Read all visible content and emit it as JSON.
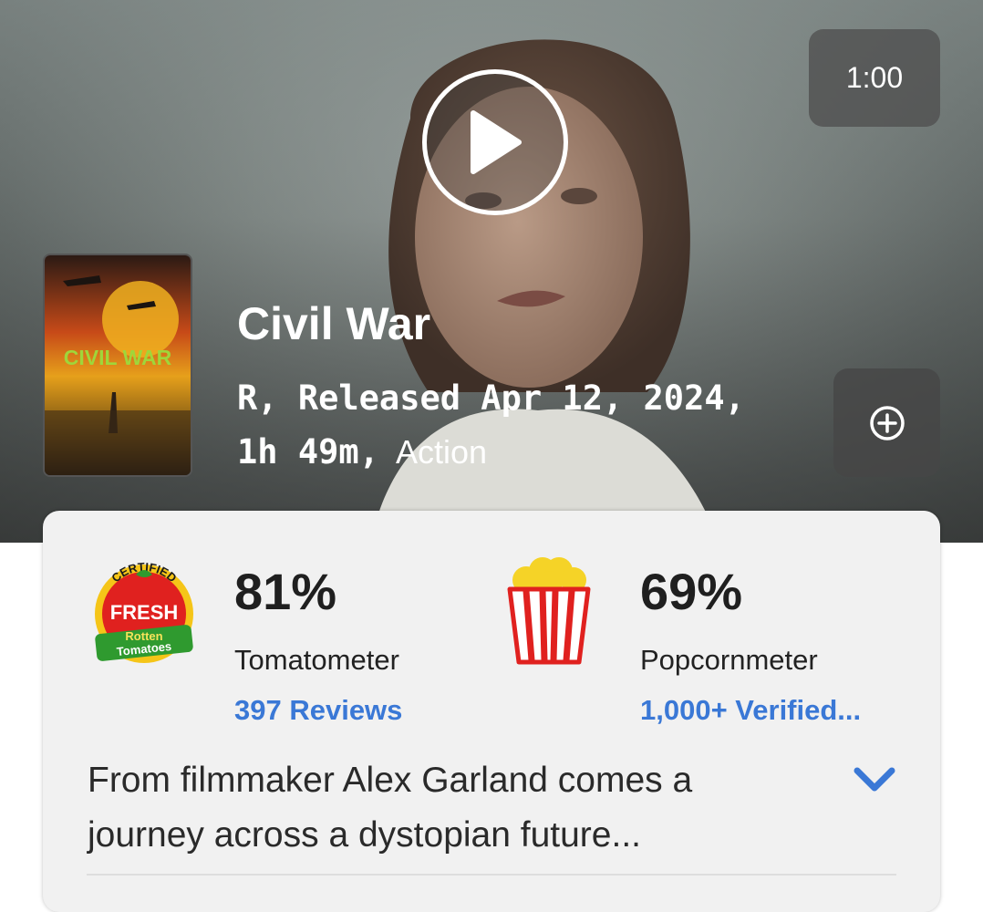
{
  "video": {
    "duration": "1:00"
  },
  "movie": {
    "title": "Civil War",
    "rating_release": "R, Released Apr 12, 2024,",
    "runtime": "1h 49m,",
    "genre": "Action",
    "poster_title": "CIVIL WAR"
  },
  "scores": {
    "tomatometer": {
      "value": "81%",
      "label": "Tomatometer",
      "link": "397 Reviews",
      "badge_top": "CERTIFIED",
      "badge_main": "FRESH",
      "badge_brand1": "Rotten",
      "badge_brand2": "Tomatoes"
    },
    "popcornmeter": {
      "value": "69%",
      "label": "Popcornmeter",
      "link": "1,000+ Verified..."
    }
  },
  "synopsis": "From filmmaker Alex Garland comes a journey across a dystopian future...",
  "colors": {
    "link": "#3a78d6",
    "card_bg": "#f1f1f1",
    "fresh_red": "#e0211f",
    "fresh_yellow": "#f5c518"
  },
  "icons": {
    "play": "play-icon",
    "add": "plus-circle-icon",
    "expand": "chevron-down-icon"
  }
}
